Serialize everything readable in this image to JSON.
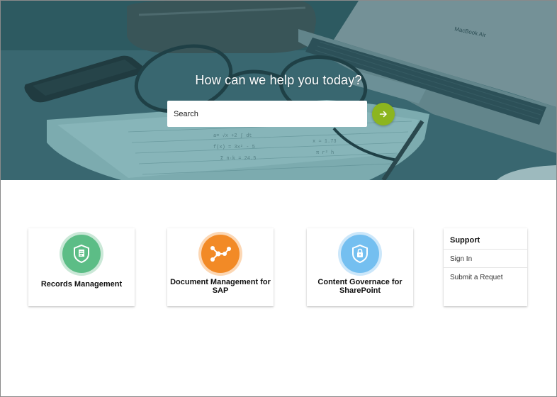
{
  "hero": {
    "title": "How can we help you today?",
    "search_placeholder": "Search",
    "search_value": "",
    "go_icon": "arrow-right-icon",
    "go_button_color": "#8cb51f"
  },
  "cards": [
    {
      "label": "Records Management",
      "icon": "document-shield-icon",
      "color": "#5cbd86"
    },
    {
      "label": "Document Management for SAP",
      "icon": "network-nodes-icon",
      "color": "#f28a26"
    },
    {
      "label": "Content Governace for SharePoint",
      "icon": "lock-shield-icon",
      "color": "#74bff0"
    }
  ],
  "support": {
    "title": "Support",
    "links": [
      "Sign In",
      "Submit a Requet"
    ]
  }
}
